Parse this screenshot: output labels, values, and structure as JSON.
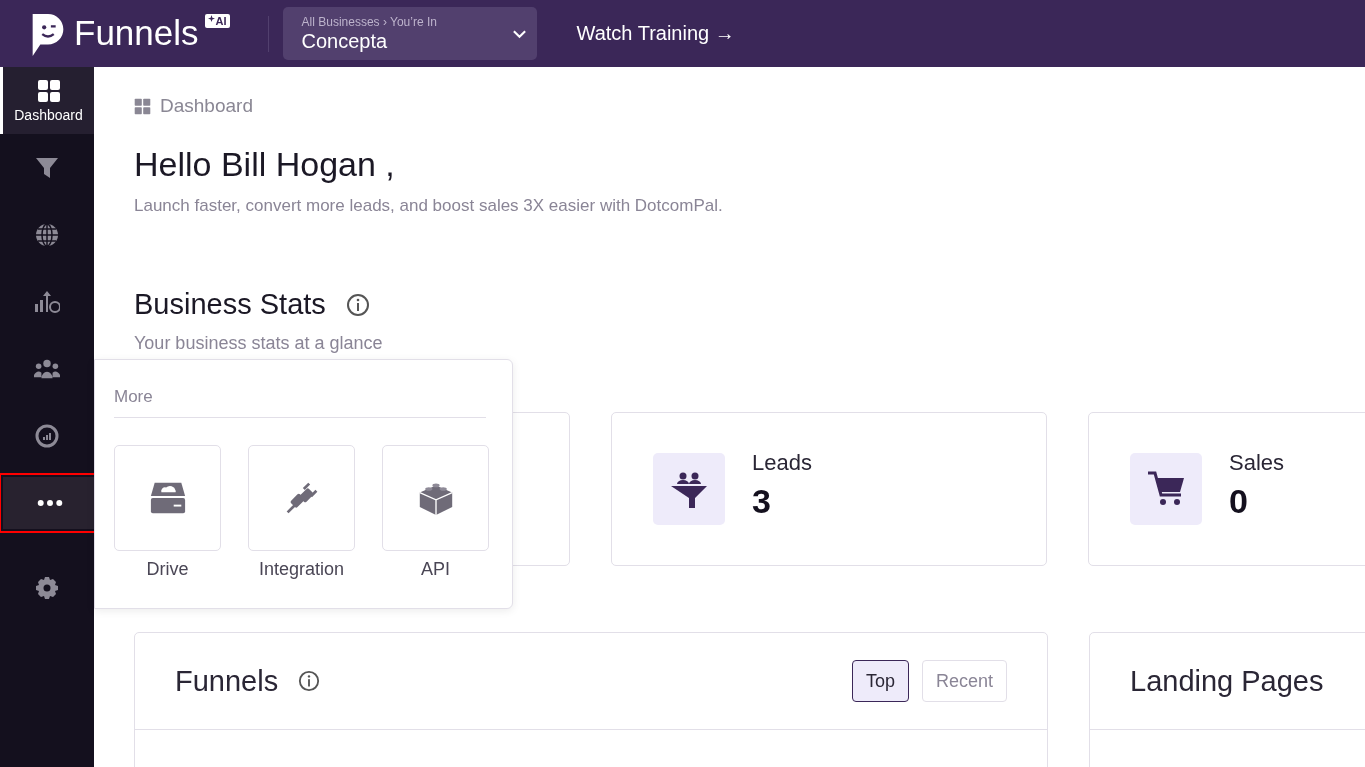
{
  "header": {
    "brand": "Funnels",
    "brand_badge": "AI",
    "business_switcher": {
      "caption": "All Businesses › You’re In",
      "value": "Concepta"
    },
    "training_link": "Watch Training →"
  },
  "sidebar": {
    "items": [
      {
        "kind": "dashboard",
        "label": "Dashboard",
        "selected": true,
        "open": false,
        "highlighted": false
      },
      {
        "kind": "funnel",
        "selected": false,
        "open": false,
        "highlighted": false
      },
      {
        "kind": "globe",
        "selected": false,
        "open": false,
        "highlighted": false
      },
      {
        "kind": "sales",
        "selected": false,
        "open": false,
        "highlighted": false
      },
      {
        "kind": "people",
        "selected": false,
        "open": false,
        "highlighted": false
      },
      {
        "kind": "gauge",
        "selected": false,
        "open": false,
        "highlighted": false
      },
      {
        "kind": "more",
        "selected": false,
        "open": true,
        "highlighted": true
      },
      {
        "kind": "settings",
        "selected": false,
        "open": false,
        "highlighted": false
      }
    ]
  },
  "breadcrumb": "Dashboard",
  "greeting": "Hello Bill Hogan ,",
  "tagline": "Launch faster, convert more leads, and boost sales 3X easier with DotcomPal.",
  "business_stats": {
    "title": "Business Stats",
    "subtitle": "Your business stats at a glance",
    "cards": [
      {
        "kind": "hidden"
      },
      {
        "kind": "leads",
        "label": "Leads",
        "value": "3"
      },
      {
        "kind": "sales",
        "label": "Sales",
        "value": "0"
      }
    ]
  },
  "more_menu": {
    "title": "More",
    "items": [
      {
        "kind": "drive",
        "label": "Drive"
      },
      {
        "kind": "integration",
        "label": "Integration"
      },
      {
        "kind": "api",
        "label": "API"
      }
    ]
  },
  "funnels_panel": {
    "title": "Funnels",
    "tabs": [
      {
        "label": "Top",
        "selected": true
      },
      {
        "label": "Recent",
        "selected": false
      }
    ]
  },
  "landing_pages_panel": {
    "title": "Landing Pages"
  }
}
